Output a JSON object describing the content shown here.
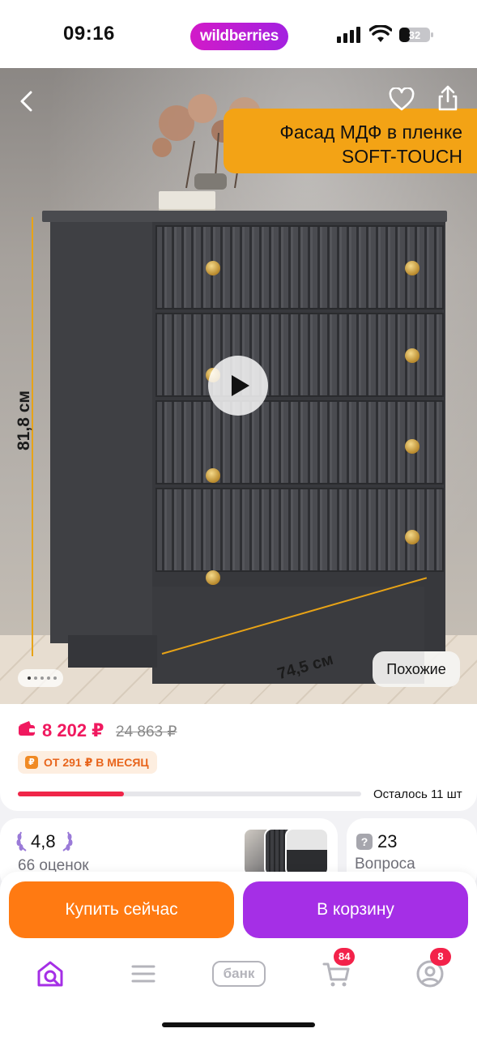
{
  "status_bar": {
    "time": "09:16",
    "brand": "wildberries",
    "battery": "32",
    "brand_gradient": [
      "#d21ac8",
      "#a321e0"
    ]
  },
  "gallery": {
    "promo_banner": [
      "Фасад МДФ в пленке",
      "SOFT-TOUCH"
    ],
    "height_label": "81,8 см",
    "width_label": "74,5 см",
    "similar_label": "Похожие",
    "pages_total": 5,
    "current_page": 1,
    "icons": [
      "chevron-left-icon",
      "heart-icon",
      "share-icon",
      "play-icon"
    ]
  },
  "price": {
    "current": "8 202 ₽",
    "old": "24 863 ₽",
    "installment": "ОТ 291 ₽ В МЕСЯЦ",
    "stock_label": "Осталось 11 шт",
    "stock_fraction": 0.31,
    "accent_color": "#f0195f"
  },
  "rating": {
    "value": "4,8",
    "count": "66 оценок"
  },
  "questions": {
    "value": "23",
    "label": "Вопроса"
  },
  "actions": {
    "buy_now": "Купить сейчас",
    "add_to_cart": "В корзину",
    "buy_color": "#ff7a12",
    "cart_color": "#a52fe6"
  },
  "tab_bar": {
    "items": [
      {
        "name": "home-search-icon",
        "active": true
      },
      {
        "name": "catalog-icon",
        "active": false
      },
      {
        "name": "bank-icon",
        "label": "банк",
        "active": false
      },
      {
        "name": "cart-icon",
        "badge": "84",
        "active": false
      },
      {
        "name": "profile-icon",
        "badge": "8",
        "active": false
      }
    ],
    "active_color": "#a52fe6"
  }
}
